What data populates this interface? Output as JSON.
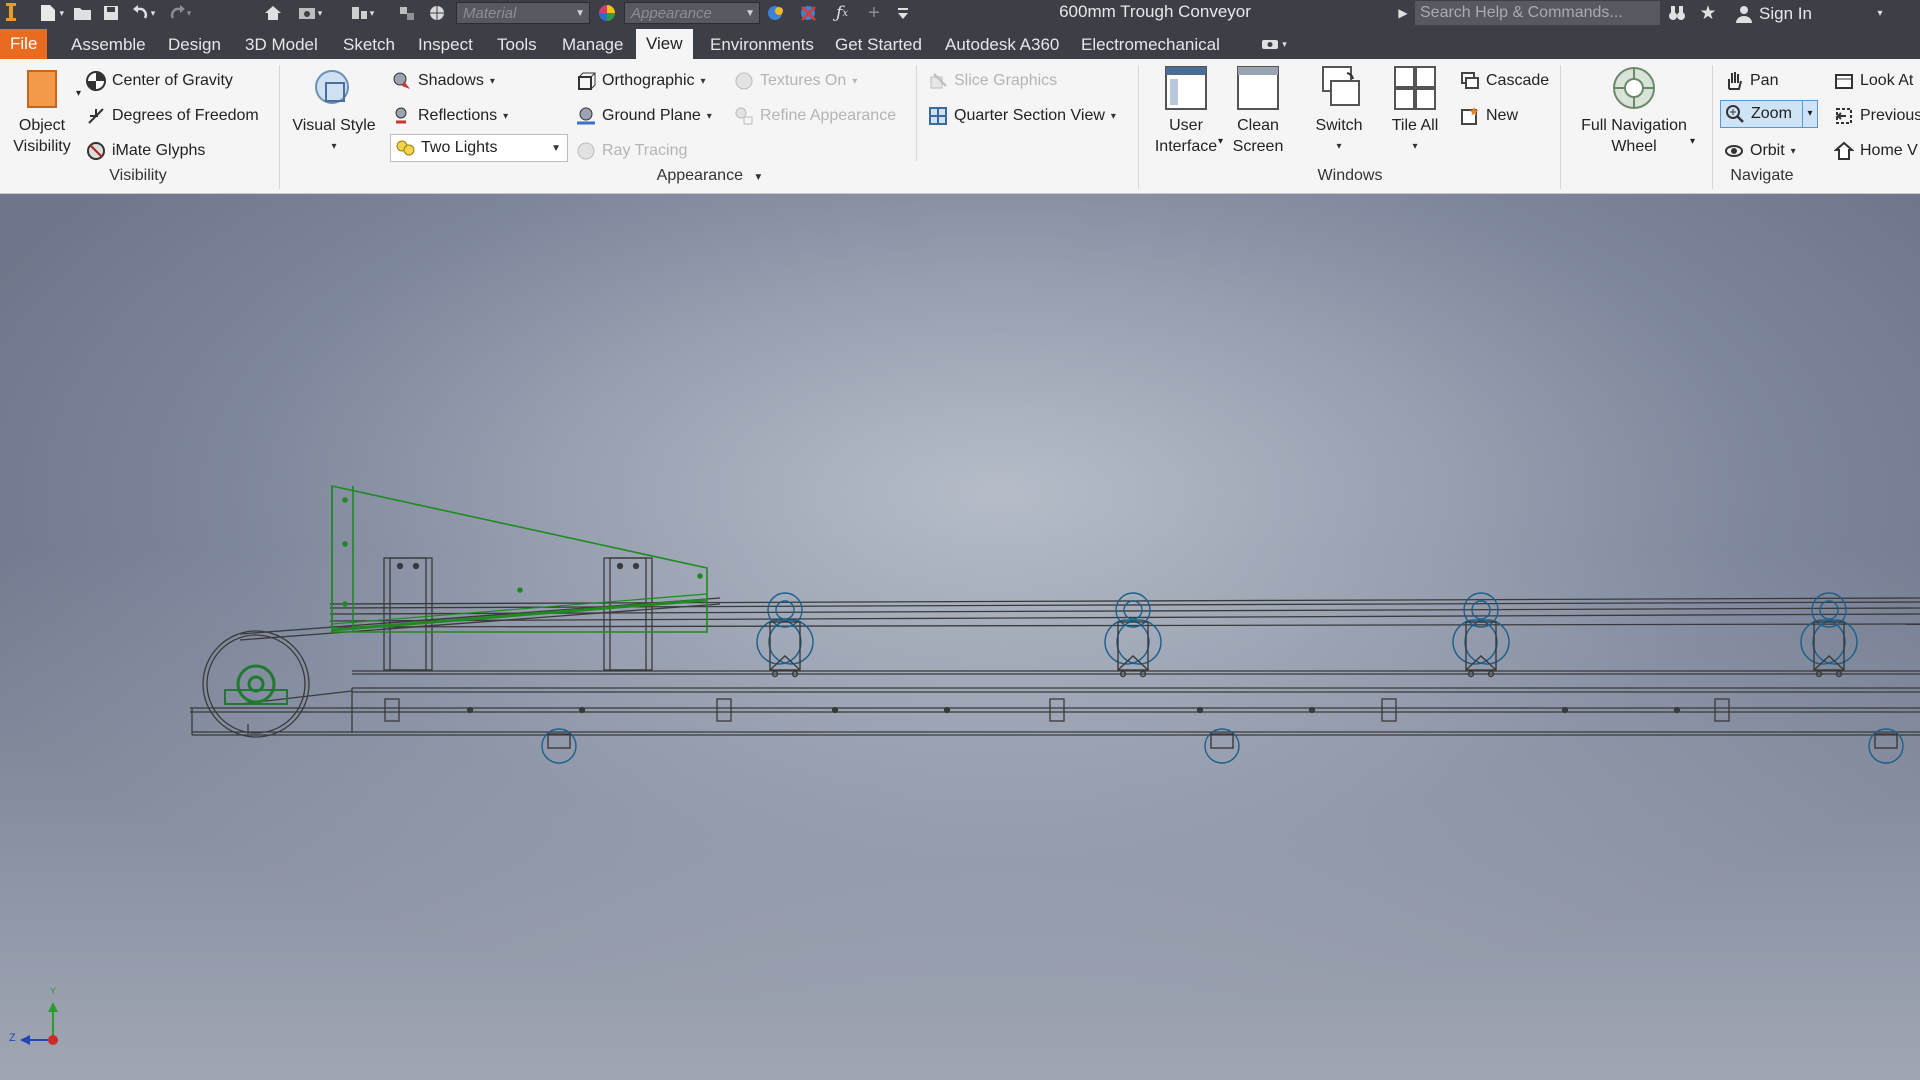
{
  "window": {
    "title": "600mm Trough Conveyor"
  },
  "quick_access": {
    "material_combo": "Material",
    "appearance_combo": "Appearance"
  },
  "search": {
    "placeholder": "Search Help & Commands..."
  },
  "account": {
    "sign_in": "Sign In"
  },
  "menu_tabs": [
    {
      "label": "File"
    },
    {
      "label": "Assemble"
    },
    {
      "label": "Design"
    },
    {
      "label": "3D Model"
    },
    {
      "label": "Sketch"
    },
    {
      "label": "Inspect"
    },
    {
      "label": "Tools"
    },
    {
      "label": "Manage"
    },
    {
      "label": "View"
    },
    {
      "label": "Environments"
    },
    {
      "label": "Get Started"
    },
    {
      "label": "Autodesk A360"
    },
    {
      "label": "Electromechanical"
    }
  ],
  "ribbon": {
    "visibility": {
      "group_label": "Visibility",
      "object_visibility": [
        "Object",
        "Visibility"
      ],
      "center_of_gravity": "Center of Gravity",
      "degrees_of_freedom": "Degrees of Freedom",
      "imate_glyphs": "iMate Glyphs"
    },
    "appearance": {
      "group_label": "Appearance",
      "visual_style": "Visual Style",
      "shadows": "Shadows",
      "reflections": "Reflections",
      "lighting": "Two Lights",
      "orthographic": "Orthographic",
      "ground_plane": "Ground Plane",
      "textures_on": "Textures On",
      "refine_appearance": "Refine Appearance",
      "ray_tracing": "Ray Tracing",
      "slice_graphics": "Slice Graphics",
      "quarter_section_view": "Quarter Section View"
    },
    "windows": {
      "group_label": "Windows",
      "user_interface": [
        "User",
        "Interface"
      ],
      "clean_screen": [
        "Clean",
        "Screen"
      ],
      "switch": "Switch",
      "tile_all": "Tile All",
      "cascade": "Cascade",
      "new": "New"
    },
    "navigate": {
      "group_label": "Navigate",
      "full_navigation_wheel": [
        "Full Navigation",
        "Wheel"
      ],
      "pan": "Pan",
      "zoom": "Zoom",
      "orbit": "Orbit",
      "look_at": "Look At",
      "previous": "Previous",
      "home_view": "Home V"
    }
  },
  "axes": {
    "z": "Z",
    "y": "Y"
  },
  "colors": {
    "file_tab": "#e86b1f",
    "selected_part": "#1f8a1f",
    "bearing_blue": "#1b5f8c",
    "wire": "#3a3a3a"
  }
}
